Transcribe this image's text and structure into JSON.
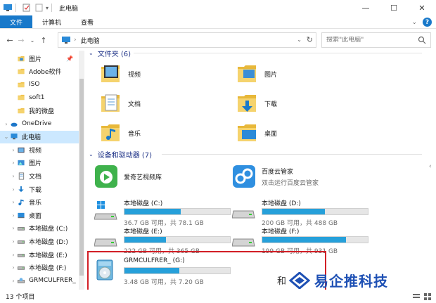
{
  "window": {
    "title": "此电脑",
    "minimize": "—",
    "maximize": "☐",
    "close": "✕"
  },
  "ribbon": {
    "tabs": [
      "文件",
      "计算机",
      "查看"
    ]
  },
  "navigation": {
    "address": "此电脑",
    "search_placeholder": "搜索\"此电脑\""
  },
  "sidebar": {
    "items": [
      {
        "label": "图片",
        "indent": 1,
        "icon": "pictures-folder-icon",
        "expander": "",
        "pinned": true
      },
      {
        "label": "Adobe软件",
        "indent": 1,
        "icon": "folder-icon",
        "expander": ""
      },
      {
        "label": "ISO",
        "indent": 1,
        "icon": "folder-icon",
        "expander": ""
      },
      {
        "label": "soft1",
        "indent": 1,
        "icon": "folder-icon",
        "expander": ""
      },
      {
        "label": "我的微盘",
        "indent": 1,
        "icon": "folder-icon",
        "expander": ""
      },
      {
        "label": "OneDrive",
        "indent": 0,
        "icon": "onedrive-icon",
        "expander": "›"
      },
      {
        "label": "此电脑",
        "indent": 0,
        "icon": "this-pc-icon",
        "expander": "⌄",
        "selected": true
      },
      {
        "label": "视频",
        "indent": 1,
        "icon": "videos-icon",
        "expander": "›"
      },
      {
        "label": "图片",
        "indent": 1,
        "icon": "pictures-icon",
        "expander": "›"
      },
      {
        "label": "文档",
        "indent": 1,
        "icon": "documents-icon",
        "expander": "›"
      },
      {
        "label": "下载",
        "indent": 1,
        "icon": "downloads-icon",
        "expander": "›"
      },
      {
        "label": "音乐",
        "indent": 1,
        "icon": "music-icon",
        "expander": "›"
      },
      {
        "label": "桌面",
        "indent": 1,
        "icon": "desktop-icon",
        "expander": "›"
      },
      {
        "label": "本地磁盘 (C:)",
        "indent": 1,
        "icon": "drive-icon",
        "expander": "›"
      },
      {
        "label": "本地磁盘 (D:)",
        "indent": 1,
        "icon": "drive-icon",
        "expander": "›"
      },
      {
        "label": "本地磁盘 (E:)",
        "indent": 1,
        "icon": "drive-icon",
        "expander": "›"
      },
      {
        "label": "本地磁盘 (F:)",
        "indent": 1,
        "icon": "drive-icon",
        "expander": "›"
      },
      {
        "label": "GRMCULFRER_",
        "indent": 1,
        "icon": "dvd-drive-icon",
        "expander": "›"
      }
    ]
  },
  "content": {
    "folders_group": "文件夹 (6)",
    "folders": [
      {
        "label": "视频",
        "icon": "videos-folder-icon"
      },
      {
        "label": "图片",
        "icon": "pictures-folder-icon"
      },
      {
        "label": "文档",
        "icon": "documents-folder-icon"
      },
      {
        "label": "下载",
        "icon": "downloads-folder-icon"
      },
      {
        "label": "音乐",
        "icon": "music-folder-icon"
      },
      {
        "label": "桌面",
        "icon": "desktop-folder-icon"
      }
    ],
    "devices_group": "设备和驱动器 (7)",
    "apps": [
      {
        "name": "爱奇艺视频库",
        "sub": "",
        "icon": "iqiyi-icon"
      },
      {
        "name": "百度云管家",
        "sub": "双击运行百度云管家",
        "icon": "baidu-cloud-icon"
      }
    ],
    "drives": [
      {
        "name": "本地磁盘 (C:)",
        "info": "36.7 GB 可用，共 78.1 GB",
        "used": 0.53,
        "icon": "windows-drive-icon"
      },
      {
        "name": "本地磁盘 (D:)",
        "info": "200 GB 可用，共 488 GB",
        "used": 0.59,
        "icon": "drive-icon"
      },
      {
        "name": "本地磁盘 (E:)",
        "info": "222 GB 可用，共 365 GB",
        "used": 0.39,
        "icon": "drive-icon"
      },
      {
        "name": "本地磁盘 (F:)",
        "info": "199 GB 可用，共 931 GB",
        "used": 0.79,
        "icon": "drive-icon"
      },
      {
        "name": "GRMCULFRER_ (G:)",
        "info": "3.48 GB 可用，共 7.20 GB",
        "used": 0.52,
        "icon": "dvd-drive-icon"
      }
    ]
  },
  "status": {
    "count": "13 个项目"
  },
  "watermark": {
    "prefix": "和",
    "brand": "易企推科技"
  },
  "colors": {
    "accent": "#1979ca",
    "bar_fill": "#26a0da",
    "highlight": "#d21f26",
    "selection": "#cce8ff"
  }
}
